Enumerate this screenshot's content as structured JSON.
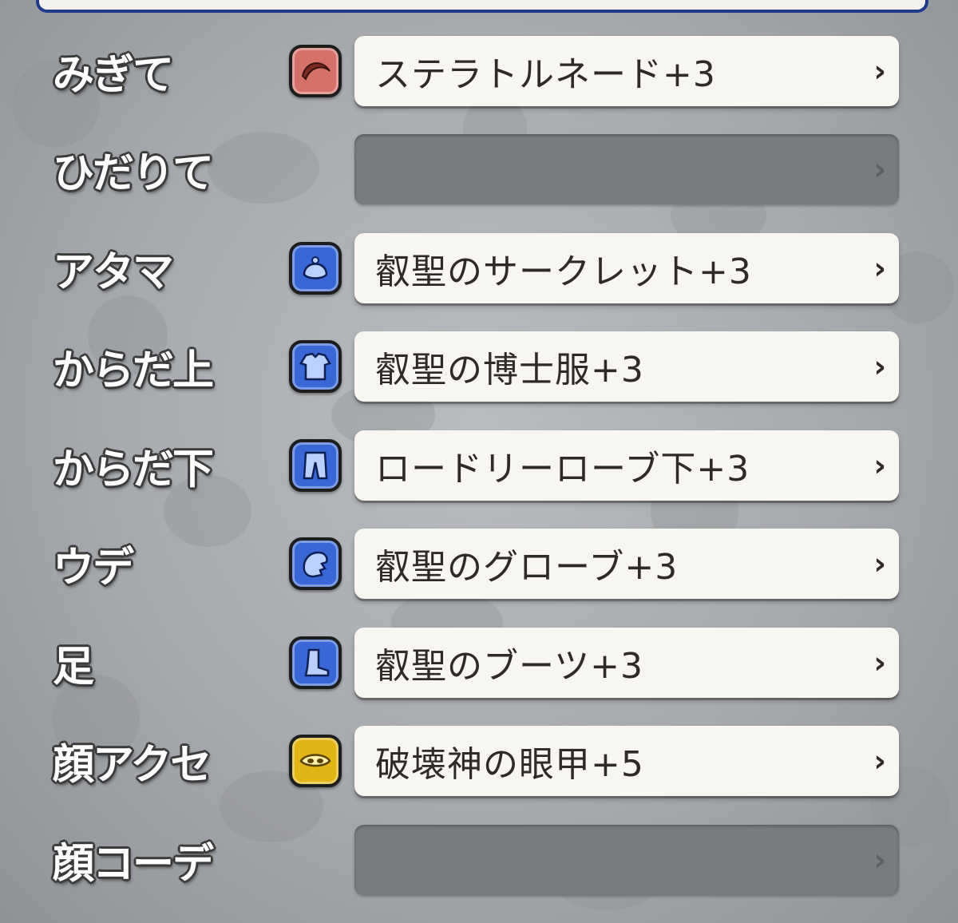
{
  "slots": [
    {
      "label": "みぎて",
      "icon": "boomerang-icon",
      "icon_color": "#d6716a",
      "item": "ステラトルネード+3"
    },
    {
      "label": "ひだりて",
      "icon": "",
      "icon_color": "",
      "item": ""
    },
    {
      "label": "アタマ",
      "icon": "headgear-icon",
      "icon_color": "#3a67d6",
      "item": "叡聖のサークレット+3"
    },
    {
      "label": "からだ上",
      "icon": "body-armor-icon",
      "icon_color": "#3a67d6",
      "item": "叡聖の博士服+3"
    },
    {
      "label": "からだ下",
      "icon": "leg-armor-icon",
      "icon_color": "#3a67d6",
      "item": "ロードリーローブ下+3"
    },
    {
      "label": "ウデ",
      "icon": "gauntlet-icon",
      "icon_color": "#3a67d6",
      "item": "叡聖のグローブ+3"
    },
    {
      "label": "足",
      "icon": "boots-icon",
      "icon_color": "#3a67d6",
      "item": "叡聖のブーツ+3"
    },
    {
      "label": "顔アクセ",
      "icon": "face-accessory-icon",
      "icon_color": "#e0b514",
      "item": "破壊神の眼甲+5"
    },
    {
      "label": "顔コーデ",
      "icon": "",
      "icon_color": "",
      "item": ""
    }
  ],
  "chevron": "›"
}
